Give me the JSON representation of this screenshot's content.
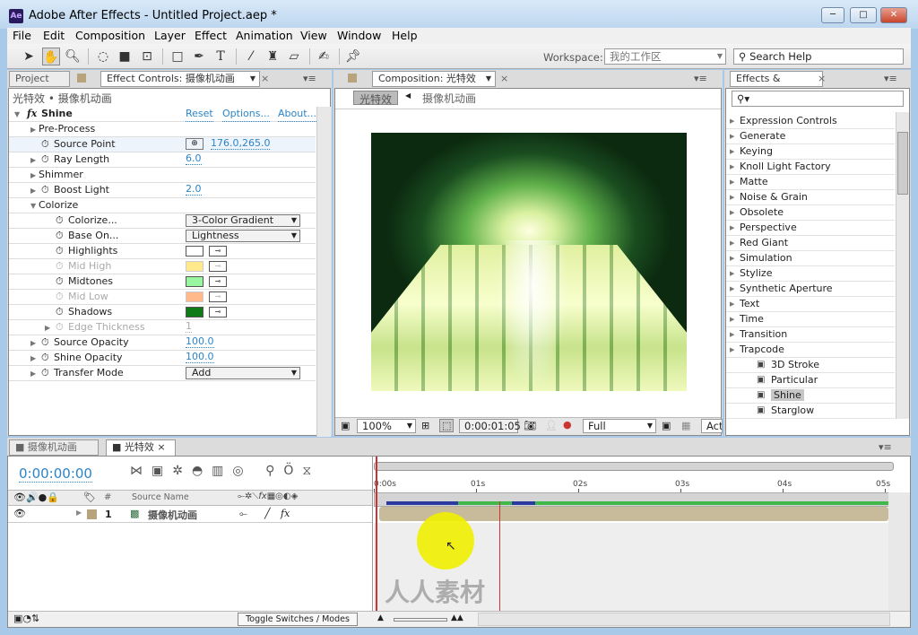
{
  "window": {
    "title": "Adobe After Effects - Untitled Project.aep *",
    "app_icon": "Ae"
  },
  "menu": [
    "File",
    "Edit",
    "Composition",
    "Layer",
    "Effect",
    "Animation",
    "View",
    "Window",
    "Help"
  ],
  "toolbar": {
    "workspace_label": "Workspace:",
    "workspace_value": "我的工作区",
    "search_placeholder": "Search Help"
  },
  "project_tab": "Project",
  "effect_controls": {
    "tab": "Effect Controls: 摄像机动画",
    "breadcrumb": "光特效 • 摄像机动画",
    "effect_name": "Shine",
    "reset": "Reset",
    "options": "Options...",
    "about": "About...",
    "rows": [
      {
        "label": "Pre-Process",
        "type": "group"
      },
      {
        "label": "Source Point",
        "value": "176.0,265.0"
      },
      {
        "label": "Ray Length",
        "value": "6.0"
      },
      {
        "label": "Shimmer",
        "type": "group"
      },
      {
        "label": "Boost Light",
        "value": "2.0"
      },
      {
        "label": "Colorize",
        "type": "group-open"
      },
      {
        "label": "Colorize...",
        "value": "3-Color Gradient"
      },
      {
        "label": "Base On...",
        "value": "Lightness"
      },
      {
        "label": "Highlights",
        "color": "#ffffff"
      },
      {
        "label": "Mid High",
        "color": "#ffe98c",
        "disabled": true
      },
      {
        "label": "Midtones",
        "color": "#99f5a0"
      },
      {
        "label": "Mid Low",
        "color": "#ffb98a",
        "disabled": true
      },
      {
        "label": "Shadows",
        "color": "#107a18"
      },
      {
        "label": "Edge Thickness",
        "value": "1",
        "disabled": true
      },
      {
        "label": "Source Opacity",
        "value": "100.0"
      },
      {
        "label": "Shine Opacity",
        "value": "100.0"
      },
      {
        "label": "Transfer Mode",
        "value": "Add"
      }
    ]
  },
  "composition": {
    "tab": "Composition: 光特效",
    "crumb_active": "光特效",
    "crumb_parent": "摄像机动画",
    "zoom": "100%",
    "timecode": "0:00:01:05",
    "resolution": "Full",
    "view": "Acti"
  },
  "effects_presets": {
    "tab": "Effects & Presets",
    "search": "",
    "items": [
      "Expression Controls",
      "Generate",
      "Keying",
      "Knoll Light Factory",
      "Matte",
      "Noise & Grain",
      "Obsolete",
      "Perspective",
      "Red Giant",
      "Simulation",
      "Stylize",
      "Synthetic Aperture",
      "Text",
      "Time",
      "Transition",
      "Trapcode"
    ],
    "subitems": [
      "3D Stroke",
      "Particular",
      "Shine",
      "Starglow"
    ],
    "selected": "Shine"
  },
  "timeline": {
    "tabs": [
      "摄像机动画",
      "光特效"
    ],
    "timecode": "0:00:00:00",
    "source_name_header": "Source Name",
    "hash_header": "#",
    "layer": {
      "index": "1",
      "name": "摄像机动画"
    },
    "ruler": [
      "0:00s",
      "01s",
      "02s",
      "03s",
      "04s",
      "05s"
    ],
    "toggle_label": "Toggle Switches / Modes"
  },
  "watermark": "人人素材"
}
